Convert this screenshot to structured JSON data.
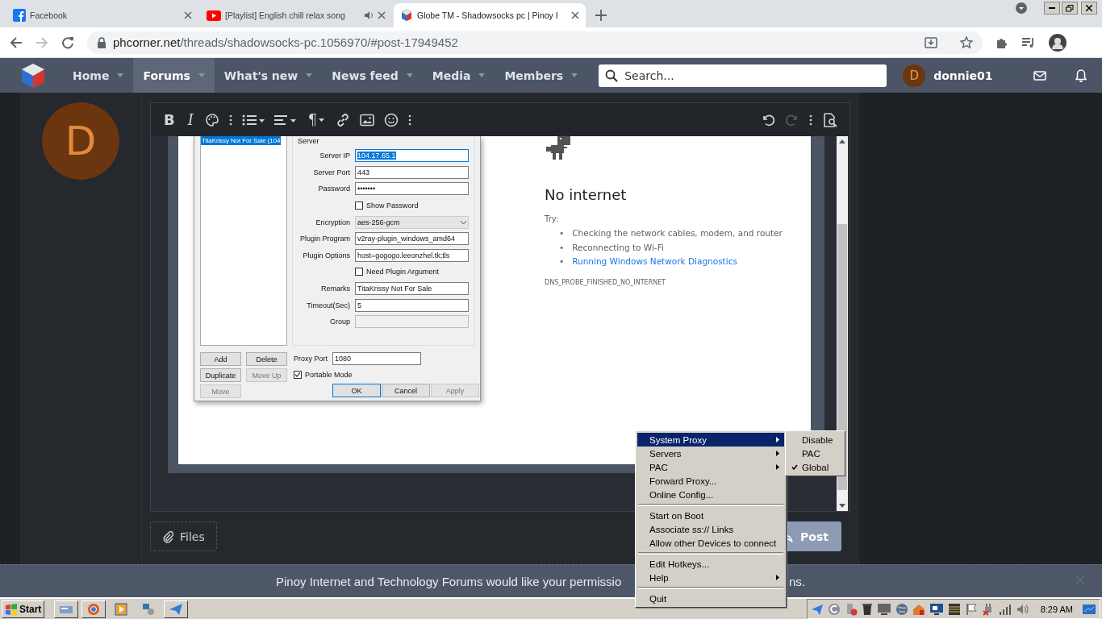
{
  "browser": {
    "tabs": [
      {
        "title": "Facebook",
        "kind": "facebook",
        "selected": false,
        "audio": false
      },
      {
        "title": "[Playlist] English chill relax song",
        "kind": "youtube",
        "selected": false,
        "audio": true
      },
      {
        "title": "Globe TM - Shadowsocks pc | Pinoy I",
        "kind": "forum",
        "selected": true,
        "audio": false
      }
    ],
    "url": {
      "host": "phcorner.net",
      "path": "/threads/shadowsocks-pc.1056970/#post-17949452"
    }
  },
  "nav": {
    "items": [
      {
        "label": "Home",
        "selected": false
      },
      {
        "label": "Forums",
        "selected": true
      },
      {
        "label": "What's new",
        "selected": false
      },
      {
        "label": "News feed",
        "selected": false
      },
      {
        "label": "Media",
        "selected": false
      },
      {
        "label": "Members",
        "selected": false
      }
    ],
    "search": {
      "placeholder": "Search..."
    },
    "user": {
      "initial": "D",
      "name": "donnie01"
    }
  },
  "post": {
    "avatar_initial": "D",
    "toolbar": [
      {
        "kind": "bold",
        "label": "B",
        "disabled": false
      },
      {
        "kind": "italic",
        "label": "I",
        "disabled": false
      },
      {
        "kind": "palette",
        "disabled": false
      },
      {
        "kind": "more",
        "disabled": false
      },
      {
        "kind": "list",
        "disabled": false
      },
      {
        "kind": "align",
        "disabled": false
      },
      {
        "kind": "paragraph",
        "label": "¶",
        "disabled": false
      },
      {
        "kind": "link",
        "disabled": false
      },
      {
        "kind": "image",
        "disabled": false
      },
      {
        "kind": "emoji",
        "disabled": false
      },
      {
        "kind": "more",
        "disabled": false
      },
      {
        "kind": "spacer"
      },
      {
        "kind": "undo",
        "disabled": false
      },
      {
        "kind": "redo",
        "disabled": true
      },
      {
        "kind": "more",
        "disabled": false
      },
      {
        "kind": "preview",
        "disabled": false
      }
    ],
    "files_button": "Files",
    "post_button": "Post"
  },
  "embedded": {
    "dialog": {
      "servers": [
        {
          "label": "TitaKrissy Not For Sale (104",
          "selected": true
        }
      ],
      "group_title": "Server",
      "fields": [
        {
          "kind": "text",
          "label": "Server IP",
          "value": "104.17.65.1",
          "focused": true,
          "disabled": false
        },
        {
          "kind": "text",
          "label": "Server Port",
          "value": "443",
          "focused": false,
          "disabled": false
        },
        {
          "kind": "text",
          "label": "Password",
          "value": "•••••••",
          "focused": false,
          "disabled": false
        },
        {
          "kind": "checkbox",
          "label": "Show Password",
          "checked": false
        },
        {
          "kind": "select",
          "label": "Encryption",
          "value": "aes-256-gcm"
        },
        {
          "kind": "text",
          "label": "Plugin Program",
          "value": "v2ray-plugin_windows_amd64",
          "focused": false,
          "disabled": false
        },
        {
          "kind": "text",
          "label": "Plugin Options",
          "value": "host=gogogo.leeonzhel.tk;tls",
          "focused": false,
          "disabled": false
        },
        {
          "kind": "checkbox",
          "label": "Need Plugin Argument",
          "checked": false
        },
        {
          "kind": "text",
          "label": "Remarks",
          "value": "TitaKrissy Not For Sale",
          "focused": false,
          "disabled": false
        },
        {
          "kind": "text",
          "label": "Timeout(Sec)",
          "value": "5",
          "focused": false,
          "disabled": false
        },
        {
          "kind": "text",
          "label": "Group",
          "focused": false,
          "disabled": true
        }
      ],
      "list_buttons": [
        {
          "label": "Add",
          "disabled": false
        },
        {
          "label": "Delete",
          "disabled": false
        },
        {
          "label": "Duplicate",
          "disabled": false
        },
        {
          "label": "Move Up",
          "disabled": true
        },
        {
          "label": "Move",
          "disabled": true
        }
      ],
      "proxy_port": {
        "label": "Proxy Port",
        "value": "1080"
      },
      "portable_mode": {
        "label": "Portable Mode",
        "checked": true
      },
      "actions": [
        {
          "label": "OK",
          "default": true,
          "disabled": false
        },
        {
          "label": "Cancel",
          "default": false,
          "disabled": false
        },
        {
          "label": "Apply",
          "default": false,
          "disabled": true
        }
      ]
    },
    "error_page": {
      "title": "No internet",
      "try": "Try:",
      "suggestions": [
        {
          "marker": "•",
          "text": "Checking the network cables, modem, and router",
          "link": false
        },
        {
          "marker": "•",
          "text": "Reconnecting to Wi-Fi",
          "link": false
        },
        {
          "marker": "•",
          "text": "Running Windows Network Diagnostics",
          "link": true
        }
      ],
      "code": "DNS_PROBE_FINISHED_NO_INTERNET"
    }
  },
  "notice": {
    "parts": [
      "Pinoy Internet and Technology Forums would like your permissio",
      "ns."
    ]
  },
  "context_menu": {
    "items": [
      {
        "kind": "item",
        "label": "System Proxy",
        "submenu": true,
        "selected": true
      },
      {
        "kind": "item",
        "label": "Servers",
        "submenu": true,
        "selected": false
      },
      {
        "kind": "item",
        "label": "PAC",
        "submenu": true,
        "selected": false
      },
      {
        "kind": "item",
        "label": "Forward Proxy...",
        "submenu": false,
        "selected": false
      },
      {
        "kind": "item",
        "label": "Online Config...",
        "submenu": false,
        "selected": false
      },
      {
        "kind": "separator"
      },
      {
        "kind": "item",
        "label": "Start on Boot",
        "submenu": false,
        "selected": false
      },
      {
        "kind": "item",
        "label": "Associate ss:// Links",
        "submenu": false,
        "selected": false
      },
      {
        "kind": "item",
        "label": "Allow other Devices to connect",
        "submenu": false,
        "selected": false
      },
      {
        "kind": "separator"
      },
      {
        "kind": "item",
        "label": "Edit Hotkeys...",
        "submenu": false,
        "selected": false
      },
      {
        "kind": "item",
        "label": "Help",
        "submenu": true,
        "selected": false
      },
      {
        "kind": "separator"
      },
      {
        "kind": "item",
        "label": "Quit",
        "submenu": false,
        "selected": false
      }
    ],
    "submenu": [
      {
        "label": "Disable",
        "checked": false
      },
      {
        "label": "PAC",
        "checked": false
      },
      {
        "label": "Global",
        "checked": true
      }
    ]
  },
  "taskbar": {
    "start": "Start",
    "time": "8:29 AM"
  }
}
